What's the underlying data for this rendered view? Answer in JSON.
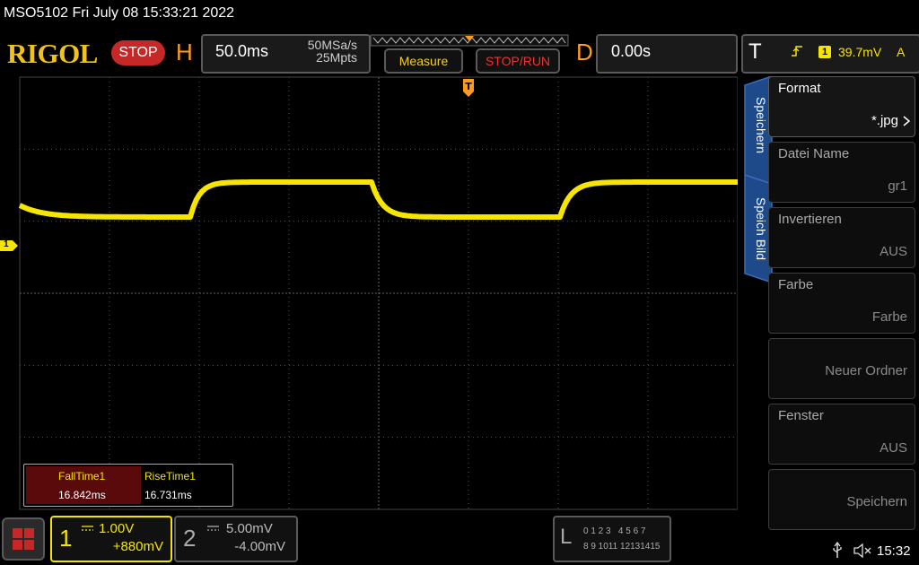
{
  "title": "MSO5102  Fri July 08 15:33:21 2022",
  "brand": "RIGOL",
  "run_state": "STOP",
  "horizontal": {
    "letter": "H",
    "time_div": "50.0ms",
    "sample_rate": "50MSa/s",
    "mem_depth": "25Mpts"
  },
  "buttons": {
    "measure": "Measure",
    "stop_run": "STOP/RUN"
  },
  "delay": {
    "letter": "D",
    "value": "0.00s"
  },
  "trigger": {
    "letter": "T",
    "channel": "1",
    "level": "39.7mV",
    "mode": "A"
  },
  "channel_marker": "1",
  "measurements": [
    {
      "name": "FallTime1",
      "value": "16.842ms"
    },
    {
      "name": "RiseTime1",
      "value": "16.731ms"
    }
  ],
  "side_tabs": [
    "Speichern",
    "Speich Bild"
  ],
  "menu": [
    {
      "label": "Format",
      "value": "*.jpg"
    },
    {
      "label": "Datei Name",
      "value": "gr1"
    },
    {
      "label": "Invertieren",
      "value": "AUS"
    },
    {
      "label": "Farbe",
      "value": "Farbe"
    },
    {
      "label": "",
      "value": "Neuer Ordner"
    },
    {
      "label": "Fenster",
      "value": "AUS"
    },
    {
      "label": "",
      "value": "Speichern"
    }
  ],
  "channels": [
    {
      "num": "1",
      "scale": "1.00V",
      "offset": "+880mV"
    },
    {
      "num": "2",
      "scale": "5.00mV",
      "offset": "-4.00mV"
    }
  ],
  "logic": {
    "letter": "L",
    "row1": "0 1 2 3   4 5 6 7",
    "row2": "8 9 1011 12131415"
  },
  "clock": "15:32",
  "colors": {
    "ch1": "#f5e500",
    "accent": "#ff9b1f",
    "stop": "#c62828",
    "tab_blue": "#1e4a8a"
  }
}
